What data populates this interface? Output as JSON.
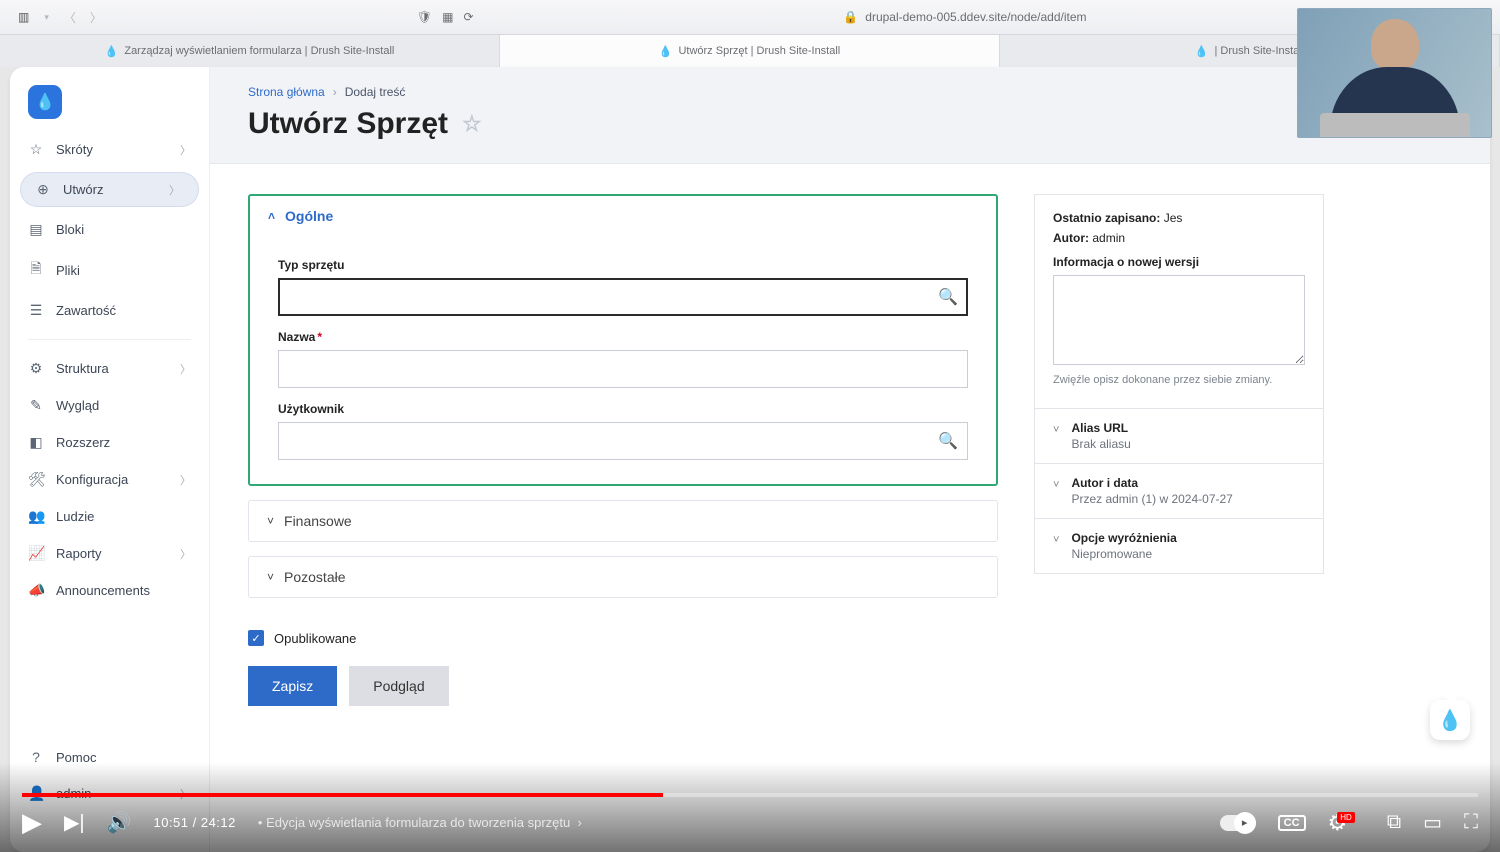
{
  "chrome": {
    "url": "drupal-demo-005.ddev.site/node/add/item"
  },
  "tabs": [
    {
      "label": "Zarządzaj wyświetlaniem formularza | Drush Site-Install",
      "active": false
    },
    {
      "label": "Utwórz Sprzęt | Drush Site-Install",
      "active": true
    },
    {
      "label": "| Drush Site-Install",
      "active": false
    }
  ],
  "sidebar": {
    "skroty": "Skróty",
    "utworz": "Utwórz",
    "bloki": "Bloki",
    "pliki": "Pliki",
    "zawartosc": "Zawartość",
    "struktura": "Struktura",
    "wyglad": "Wygląd",
    "rozszerz": "Rozszerz",
    "konfiguracja": "Konfiguracja",
    "ludzie": "Ludzie",
    "raporty": "Raporty",
    "announcements": "Announcements",
    "pomoc": "Pomoc",
    "admin": "admin"
  },
  "breadcrumb": {
    "root": "Strona główna",
    "leaf": "Dodaj treść"
  },
  "title": "Utwórz Sprzęt",
  "fsets": {
    "ogolne": {
      "label": "Ogólne",
      "typ_label": "Typ sprzętu",
      "nazwa_label": "Nazwa",
      "uzytkownik_label": "Użytkownik"
    },
    "finansowe": {
      "label": "Finansowe"
    },
    "pozostale": {
      "label": "Pozostałe"
    }
  },
  "publish": {
    "label": "Opublikowane",
    "checked": true
  },
  "buttons": {
    "save": "Zapisz",
    "preview": "Podgląd"
  },
  "aside": {
    "saved_label": "Ostatnio zapisano:",
    "saved_value": "Jes",
    "author_label": "Autor:",
    "author_value": "admin",
    "rev_label": "Informacja o nowej wersji",
    "rev_help": "Zwięźle opisz dokonane przez siebie zmiany.",
    "alias_title": "Alias URL",
    "alias_sub": "Brak aliasu",
    "autor_title": "Autor i data",
    "autor_sub": "Przez admin (1) w 2024-07-27",
    "promo_title": "Opcje wyróżnienia",
    "promo_sub": "Niepromowane"
  },
  "video": {
    "time": "10:51 / 24:12",
    "chapter": "Edycja wyświetlania formularza do tworzenia sprzętu"
  }
}
